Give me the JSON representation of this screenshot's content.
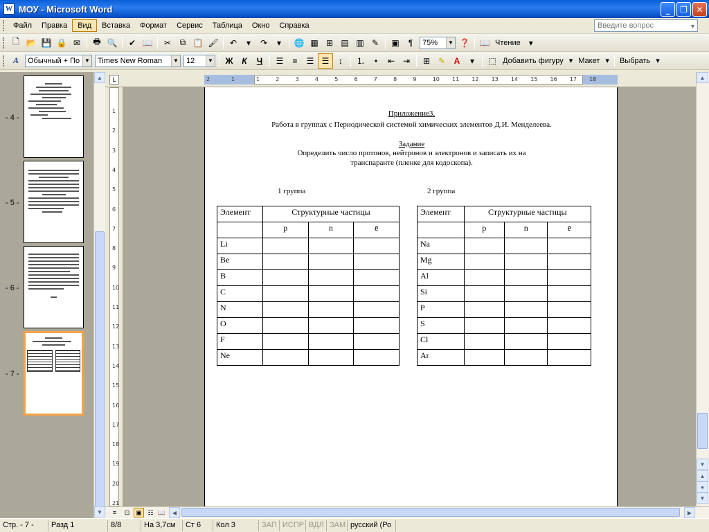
{
  "window": {
    "title": "МОУ - Microsoft Word",
    "icon_letter": "W"
  },
  "menu": {
    "items": [
      "Файл",
      "Правка",
      "Вид",
      "Вставка",
      "Формат",
      "Сервис",
      "Таблица",
      "Окно",
      "Справка"
    ],
    "active": "Вид",
    "help_placeholder": "Введите вопрос"
  },
  "toolbar1": {
    "zoom": "75%",
    "reading_label": "Чтение"
  },
  "toolbar2": {
    "style": "Обычный + По ц",
    "font": "Times New Roman",
    "size": "12",
    "bold": "Ж",
    "italic": "К",
    "underline": "Ч",
    "add_shape": "Добавить фигуру",
    "layout": "Макет",
    "select": "Выбрать"
  },
  "thumbnails": {
    "pages": [
      {
        "label": "- 4 -"
      },
      {
        "label": "- 5 -"
      },
      {
        "label": "- 6 -"
      },
      {
        "label": "- 7 -",
        "selected": true
      }
    ]
  },
  "ruler": {
    "h_ticks": [
      "2",
      "1",
      "1",
      "2",
      "3",
      "4",
      "5",
      "6",
      "7",
      "8",
      "9",
      "10",
      "11",
      "12",
      "13",
      "14",
      "15",
      "16",
      "17",
      "18"
    ],
    "v_ticks": [
      "1",
      "2",
      "3",
      "4",
      "5",
      "6",
      "7",
      "8",
      "9",
      "10",
      "11",
      "12",
      "13",
      "14",
      "15",
      "16",
      "17",
      "18",
      "19",
      "20",
      "21"
    ]
  },
  "document": {
    "appendix": "Приложение3.",
    "subtitle": "Работа в группах с Периодической системой химических элементов Д.И. Менделеева.",
    "task_heading": "Задание",
    "task_line1": "Определить число протонов, нейтронов и электронов и записать их на",
    "task_line2": "транспаранте (пленке для кодоскопа).",
    "group1_label": "1 группа",
    "group2_label": "2 группа",
    "table_headers": {
      "element": "Элемент",
      "particles": "Структурные частицы",
      "p": "p",
      "n": "n",
      "e": "ē"
    },
    "group1_elements": [
      "Li",
      "Be",
      "B",
      "C",
      "N",
      "O",
      "F",
      "Ne"
    ],
    "group2_elements": [
      "Na",
      "Mg",
      "Al",
      "Si",
      "P",
      "S",
      "Cl",
      "Ar"
    ]
  },
  "status": {
    "page": "Стр. - 7 -",
    "section": "Разд 1",
    "pages": "8/8",
    "at": "На 3,7см",
    "line": "Ст 6",
    "col": "Кол 3",
    "rec": "ЗАП",
    "trk": "ИСПР",
    "ext": "ВДЛ",
    "ovr": "ЗАМ",
    "language": "русский (Ро"
  },
  "colors": {
    "title_bar": "#0A5FD8",
    "ui_bg": "#ECE9D8",
    "workspace": "#ABA899",
    "selection": "#F6A348"
  }
}
